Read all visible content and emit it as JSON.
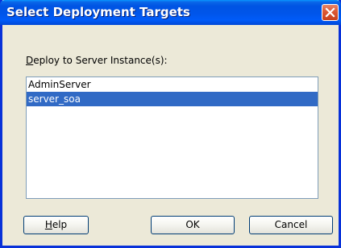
{
  "window": {
    "title": "Select Deployment Targets"
  },
  "targets": {
    "label_mnemonic": "D",
    "label_rest": "eploy to Server Instance(s):",
    "items": [
      "AdminServer",
      "server_soa"
    ],
    "selected": "server_soa"
  },
  "buttons": {
    "help_mnemonic": "H",
    "help_rest": "elp",
    "ok": "OK",
    "cancel": "Cancel"
  },
  "colors": {
    "titlebar": "#0054e3",
    "selection": "#316ac5",
    "dialog_bg": "#ece9d8"
  }
}
